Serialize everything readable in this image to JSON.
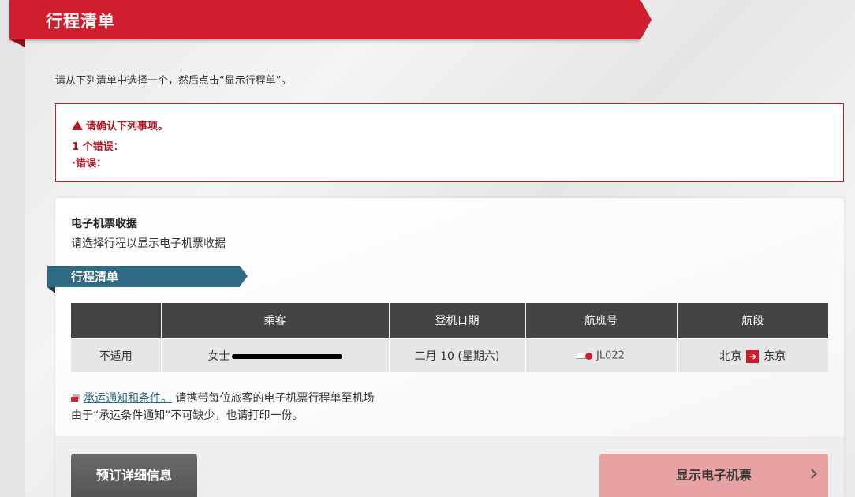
{
  "header": {
    "title": "行程清单"
  },
  "instruction": "请从下列清单中选择一个，然后点击“显示行程单”。",
  "error_box": {
    "title": "请确认下列事项。",
    "count": "1 个错误：",
    "item": "·错误："
  },
  "receipt": {
    "title": "电子机票收据",
    "subtitle": "请选择行程以显示电子机票收据"
  },
  "itinerary": {
    "title": "行程清单",
    "columns": [
      "",
      "乘客",
      "登机日期",
      "航班号",
      "航段"
    ],
    "rows": [
      {
        "select": "不适用",
        "passenger": "女士",
        "date": "二月 10 (星期六)",
        "flight": "JL022",
        "from": "北京",
        "to": "东京"
      }
    ]
  },
  "notice": {
    "link": "承运通知和条件。",
    "line1_rest": "请携带每位旅客的电子机票行程单至机场",
    "line2": "由于“承运条件通知”不可缺少，也请打印一份。"
  },
  "buttons": {
    "details": "预订详细信息",
    "show_ticket": "显示电子机票"
  },
  "colors": {
    "brand_red": "#cf1f2e",
    "ribbon_teal": "#2f6b82",
    "table_header": "#444444",
    "show_button": "#e9a2a4"
  },
  "icons": [
    "warning-icon",
    "jal-logo-icon",
    "arrow-right-icon",
    "document-icon",
    "chevron-right-icon"
  ]
}
